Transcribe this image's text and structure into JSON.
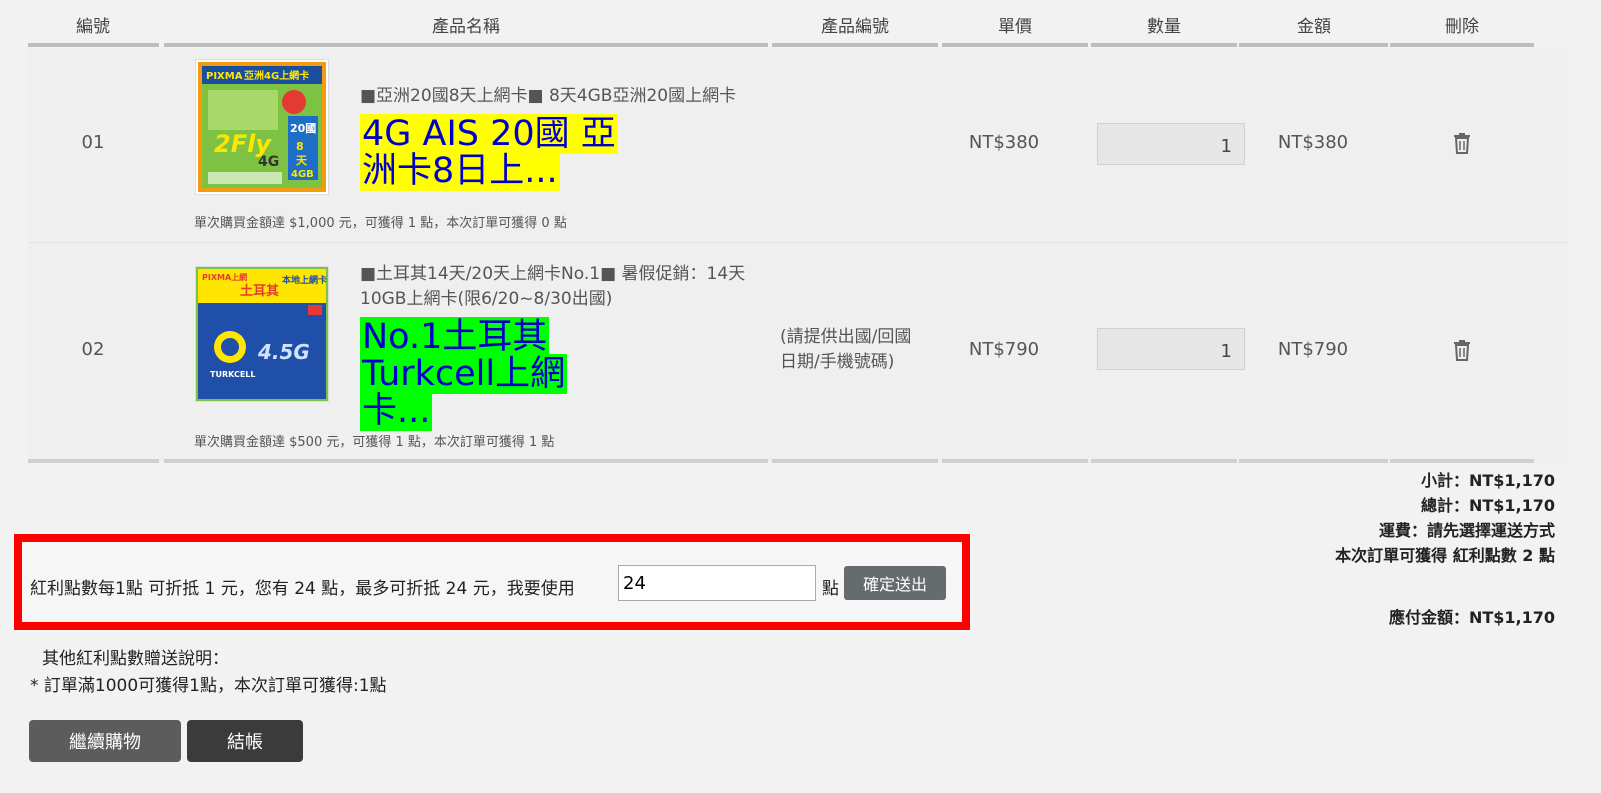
{
  "table": {
    "headers": [
      "編號",
      "產品名稱",
      "產品編號",
      "單價",
      "數量",
      "金額",
      "刪除"
    ]
  },
  "items": [
    {
      "no": "01",
      "name_line1": "■亞洲20國8天上網卡■ 8天4GB亞洲20國上網卡",
      "big_line1": "4G AIS 20國 亞",
      "big_line2": "洲卡8日上...",
      "big_color": "#0000cc",
      "big_bg": "#ffff00",
      "thumb_brand": "PIXMA",
      "thumb_title": "亞洲4G上網卡",
      "thumb_big": "20國",
      "thumb_days": "8天",
      "thumb_data": "4GB",
      "bonus_note": "單次購買金額達 $1,000 元，可獲得 1 點，本次訂單可獲得 0 點",
      "product_code": "",
      "price": "NT$380",
      "qty": "1",
      "amount": "NT$380"
    },
    {
      "no": "02",
      "name_line1": "■土耳其14天/20天上網卡No.1■ 暑假促銷：14天",
      "name_line2": "10GB上網卡(限6/20~8/30出國)",
      "big_line1": "No.1土耳其",
      "big_line2": "Turkcell上網",
      "big_line3": "卡...",
      "big_color": "#0000cc",
      "big_bg": "#00ff00",
      "thumb_brand": "PIXMA上網",
      "thumb_title": "本地上網卡",
      "thumb_country": "土耳其",
      "thumb_net": "4.5G",
      "thumb_carrier": "TURKCELL",
      "bonus_note": "單次購買金額達 $500 元，可獲得 1 點，本次訂單可獲得 1 點",
      "product_code_line1": "(請提供出國/回國",
      "product_code_line2": "日期/手機號碼)",
      "price": "NT$790",
      "qty": "1",
      "amount": "NT$790"
    }
  ],
  "summary": {
    "subtotal": "小計：NT$1,170",
    "total": "總計：NT$1,170",
    "shipping": "運費：請先選擇運送方式",
    "points_earned": "本次訂單可獲得 紅利點數 2 點",
    "payable": "應付金額：NT$1,170"
  },
  "points": {
    "text": "紅利點數每1點 可折抵 1 元，您有 24 點，最多可折抵 24 元，我要使用",
    "input_value": "24",
    "unit": "點",
    "submit_label": "確定送出",
    "highlight_color": "#ff0000"
  },
  "other": {
    "title": "其他紅利點數贈送說明：",
    "line": "* 訂單滿1000可獲得1點，本次訂單可獲得:1點"
  },
  "buttons": {
    "continue_label": "繼續購物",
    "checkout_label": "結帳"
  },
  "icons": {
    "delete": "trash-icon"
  }
}
